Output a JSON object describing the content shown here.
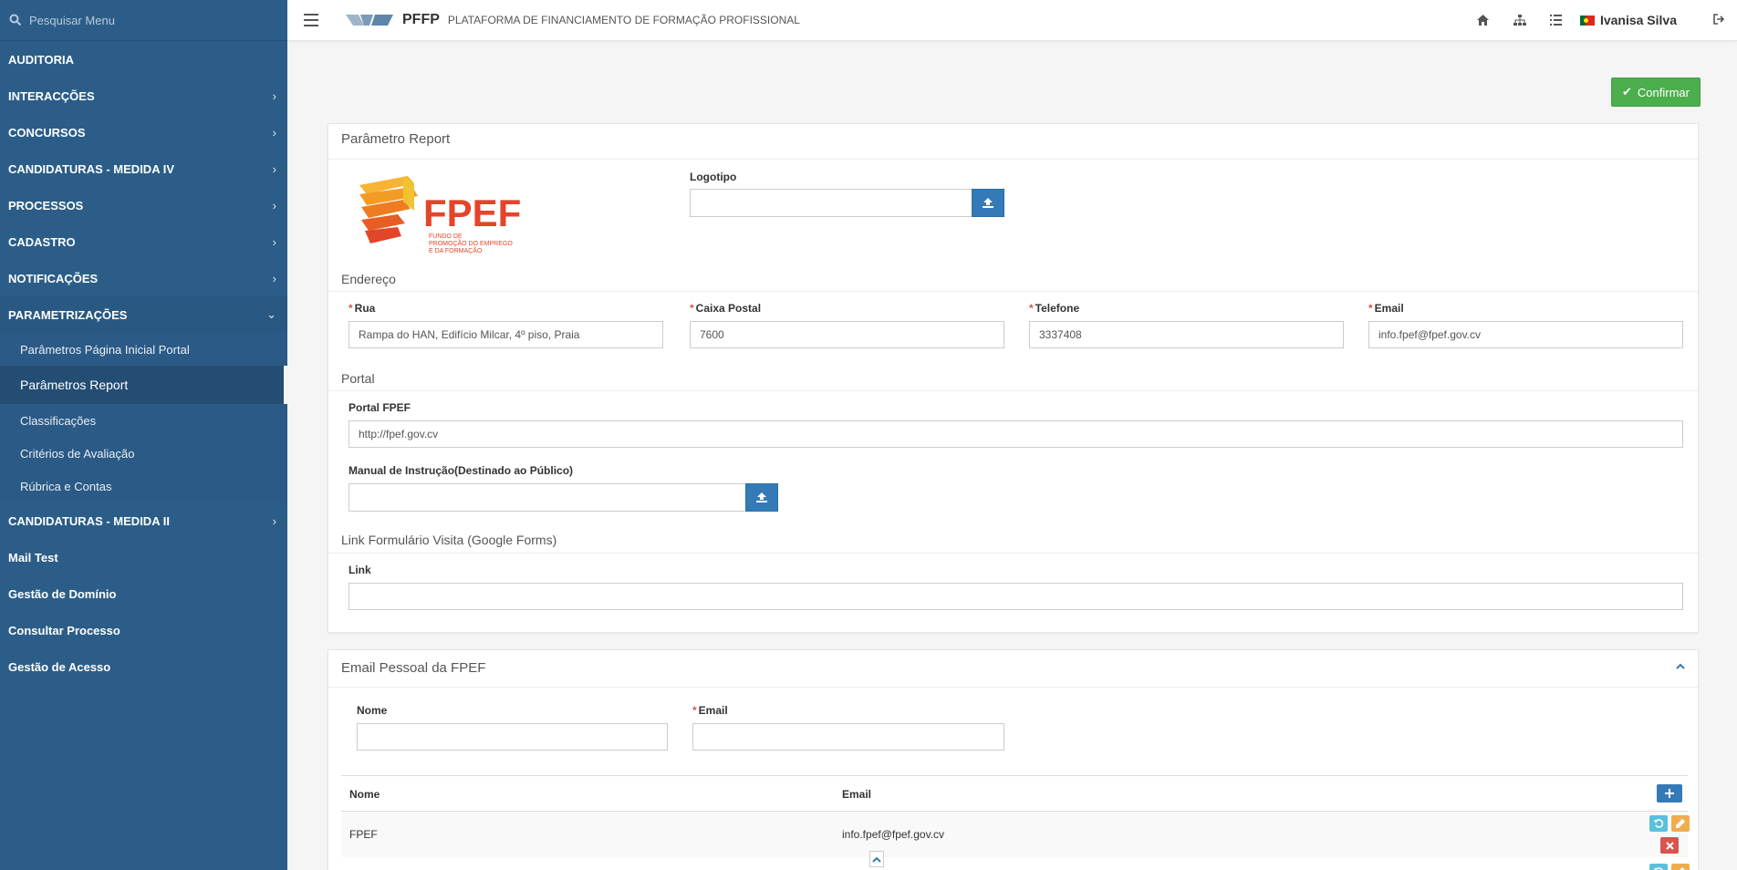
{
  "sidebar": {
    "search_placeholder": "Pesquisar Menu",
    "items": [
      {
        "label": "AUDITORIA"
      },
      {
        "label": "INTERACÇÕES"
      },
      {
        "label": "CONCURSOS"
      },
      {
        "label": "CANDIDATURAS - MEDIDA IV"
      },
      {
        "label": "PROCESSOS"
      },
      {
        "label": "CADASTRO"
      },
      {
        "label": "NOTIFICAÇÕES"
      },
      {
        "label": "PARAMETRIZAÇÕES"
      }
    ],
    "sub_items": [
      {
        "label": "Parâmetros Página Inicial Portal"
      },
      {
        "label": "Parâmetros Report"
      },
      {
        "label": "Classificações"
      },
      {
        "label": "Critérios de Avaliação"
      },
      {
        "label": "Rúbrica e Contas"
      }
    ],
    "after_items": [
      {
        "label": "CANDIDATURAS - MEDIDA II"
      },
      {
        "label": "Mail Test"
      },
      {
        "label": "Gestão de Domínio"
      },
      {
        "label": "Consultar Processo"
      },
      {
        "label": "Gestão de Acesso"
      }
    ]
  },
  "topbar": {
    "brand": "PFFP",
    "subtitle": "PLATAFORMA DE FINANCIAMENTO DE FORMAÇÃO PROFISSIONAL",
    "user": "Ivanisa Silva"
  },
  "actions": {
    "confirm": "Confirmar"
  },
  "panel1": {
    "title": "Parâmetro Report",
    "logo_text": "FPEF",
    "logo_caption": [
      "FUNDO DE",
      "PROMOÇÃO DO EMPREGO",
      "E DA FORMAÇÃO"
    ],
    "logotipo_label": "Logotipo",
    "endereco_title": "Endereço",
    "rua_label": "Rua",
    "rua_value": "Rampa do HAN, Edifício Milcar, 4º piso, Praia",
    "caixa_label": "Caixa Postal",
    "caixa_value": "7600",
    "telefone_label": "Telefone",
    "telefone_value": "3337408",
    "email_label": "Email",
    "email_value": "info.fpef@fpef.gov.cv",
    "portal_title": "Portal",
    "portal_label": "Portal FPEF",
    "portal_value": "http://fpef.gov.cv",
    "manual_label": "Manual de Instrução(Destinado ao Público)",
    "link_title": "Link Formulário Visita (Google Forms)",
    "link_label": "Link",
    "link_value": ""
  },
  "panel2": {
    "title": "Email Pessoal da FPEF",
    "nome_label": "Nome",
    "email_label": "Email",
    "table": {
      "headers": [
        "Nome",
        "Email"
      ],
      "rows": [
        {
          "nome": "FPEF",
          "email": "info.fpef@fpef.gov.cv"
        }
      ]
    }
  },
  "colors": {
    "sidebar": "#2b5d88",
    "primary": "#337ab7",
    "success": "#4cae4c",
    "danger": "#d9534f",
    "warning": "#f0ad4e",
    "info": "#5bc0de"
  }
}
